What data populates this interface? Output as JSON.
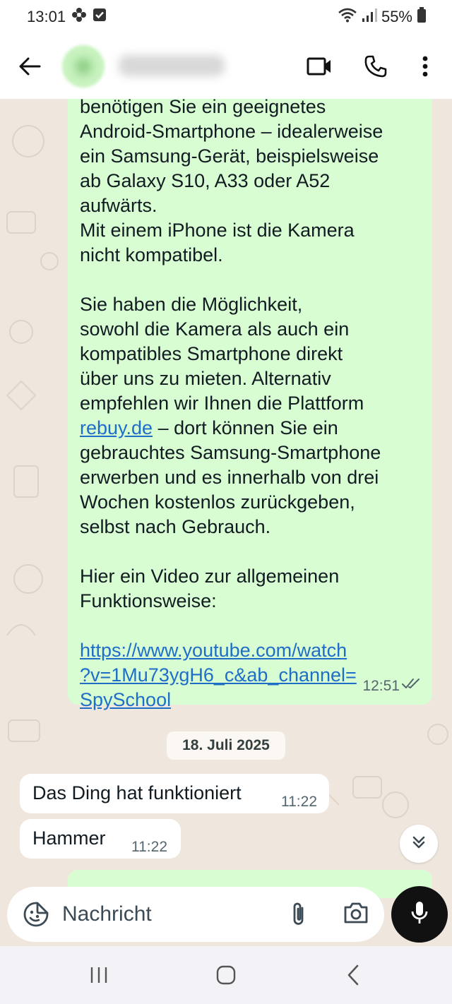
{
  "status_bar": {
    "time": "13:01",
    "battery": "55%"
  },
  "header": {
    "icons": [
      "back-arrow-icon",
      "video-call-icon",
      "phone-icon",
      "more-vert-icon"
    ]
  },
  "messages": {
    "outgoing": {
      "lines_before_gap1": [
        "benötigen Sie ein geeignetes",
        "Android-Smartphone – idealerweise",
        "ein Samsung-Gerät, beispielsweise",
        "ab Galaxy S10, A33 oder A52",
        "aufwärts.",
        "Mit einem iPhone ist die Kamera",
        "nicht kompatibel."
      ],
      "para2_lines": [
        "Sie haben die Möglichkeit,",
        "sowohl die Kamera als auch ein",
        "kompatibles Smartphone direkt",
        "über uns zu mieten. Alternativ",
        "empfehlen wir Ihnen die Plattform"
      ],
      "link_rebuy": "rebuy.de",
      "after_link": " – dort können Sie ein",
      "para2_tail": [
        "gebrauchtes Samsung-Smartphone",
        "erwerben und es innerhalb von drei",
        "Wochen kostenlos zurückgeben,",
        "selbst nach Gebrauch."
      ],
      "para3_lines": [
        "Hier ein Video zur allgemeinen",
        "Funktionsweise:"
      ],
      "youtube_lines": [
        "https://www.youtube.com/watch",
        "?v=1Mu73ygH6_c&ab_channel=",
        "SpySchool"
      ],
      "time": "12:51"
    },
    "date_divider": "18. Juli 2025",
    "incoming": [
      {
        "text": "Das Ding hat funktioniert",
        "time": "11:22"
      },
      {
        "text": "Hammer",
        "time": "11:22"
      }
    ]
  },
  "composer": {
    "placeholder": "Nachricht"
  },
  "colors": {
    "outgoing_bubble": "#d9fdd3",
    "chat_background": "#efe7de",
    "link": "#1e6ec8"
  }
}
